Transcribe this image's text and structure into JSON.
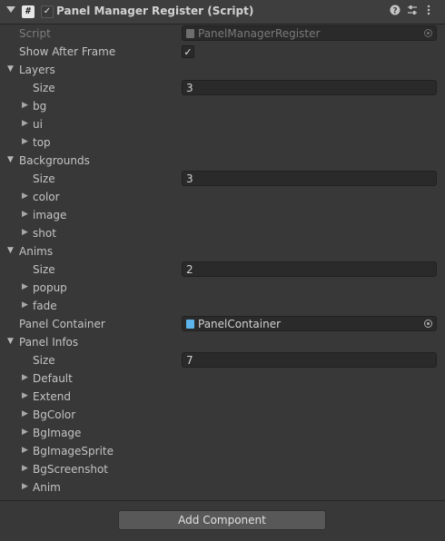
{
  "header": {
    "title": "Panel Manager Register (Script)",
    "enabled_check": "✓",
    "script_icon": "#",
    "icons": [
      "help-icon",
      "preset-icon",
      "more-menu-icon"
    ]
  },
  "rows": {
    "script": {
      "label": "Script",
      "value": "PanelManagerRegister"
    },
    "show_after_frame": {
      "label": "Show After Frame",
      "checked": true,
      "check": "✓"
    },
    "layers": {
      "label": "Layers",
      "size_label": "Size",
      "size": "3",
      "items": [
        "bg",
        "ui",
        "top"
      ]
    },
    "backgrounds": {
      "label": "Backgrounds",
      "size_label": "Size",
      "size": "3",
      "items": [
        "color",
        "image",
        "shot"
      ]
    },
    "anims": {
      "label": "Anims",
      "size_label": "Size",
      "size": "2",
      "items": [
        "popup",
        "fade"
      ]
    },
    "panel_container": {
      "label": "Panel Container",
      "value": "PanelContainer"
    },
    "panel_infos": {
      "label": "Panel Infos",
      "size_label": "Size",
      "size": "7",
      "items": [
        "Default",
        "Extend",
        "BgColor",
        "BgImage",
        "BgImageSprite",
        "BgScreenshot",
        "Anim"
      ]
    }
  },
  "add_component": "Add Component",
  "colors": {
    "background": "#383838",
    "field": "#2a2a2a",
    "button": "#585858",
    "prefab_icon": "#5cb4ec"
  }
}
